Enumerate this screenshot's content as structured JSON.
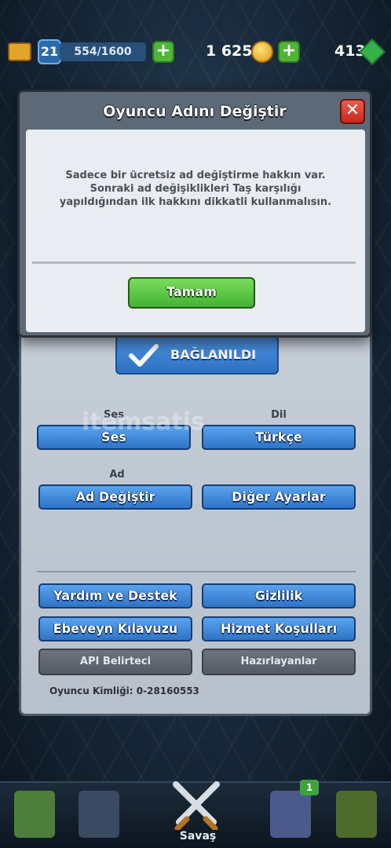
{
  "topbar": {
    "level": "21",
    "xp": "554/1600",
    "gold": "1 625",
    "gems": "413"
  },
  "modal": {
    "title": "Oyuncu Adını Değiştir",
    "close_symbol": "✕",
    "message": "Sadece bir ücretsiz ad değiştirme hakkın var. Sonraki ad değişiklikleri Taş karşılığı yapıldığından ilk hakkını dikkatli kullanmalısın.",
    "ok_label": "Tamam"
  },
  "settings": {
    "connected_label": "BAĞLANILDI",
    "sound_section": "Ses",
    "sound_button": "Ses",
    "language_section": "Dil",
    "language_button": "Türkçe",
    "name_section": "Ad",
    "change_name_button": "Ad Değiştir",
    "other_settings_button": "Diğer Ayarlar",
    "help_button": "Yardım ve Destek",
    "privacy_button": "Gizlilik",
    "parents_guide_button": "Ebeveyn Kılavuzu",
    "terms_button": "Hizmet Koşulları",
    "api_token_button": "API Belirteci",
    "credits_button": "Hazırlayanlar",
    "player_id": "Oyuncu Kimliği: 0-28160553"
  },
  "bottom_nav": {
    "battle_label": "Savaş",
    "clan_badge": "1"
  },
  "watermark": "itemsatis",
  "icons": [
    "chest-icon",
    "level-icon",
    "plus-icon",
    "coin-icon",
    "gem-icon",
    "close-icon",
    "check-icon",
    "shop-icon",
    "cards-icon",
    "battle-swords-icon",
    "clan-icon",
    "events-icon"
  ]
}
